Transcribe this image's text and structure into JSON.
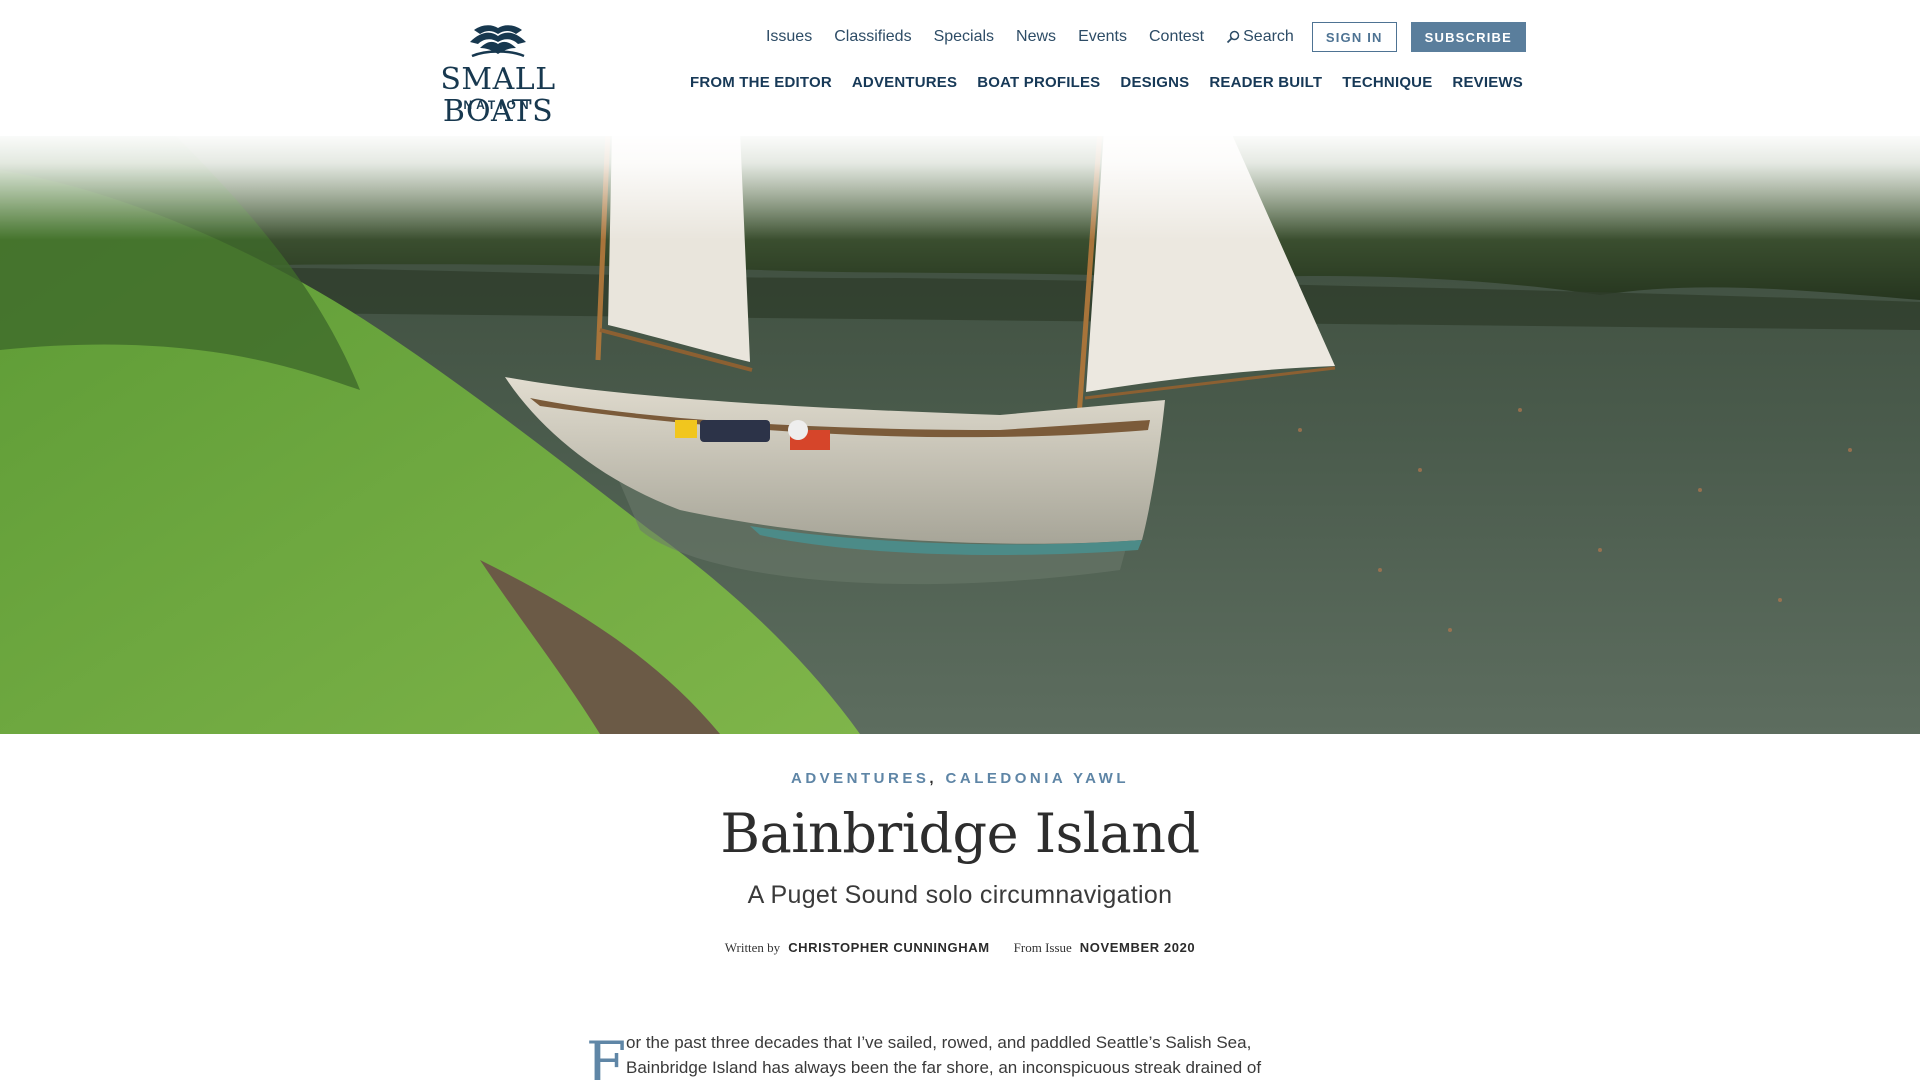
{
  "header": {
    "logo": {
      "title": "SMALL BOATS",
      "subtitle": "NATION"
    },
    "utility_nav": [
      "Issues",
      "Classifieds",
      "Specials",
      "News",
      "Events",
      "Contest"
    ],
    "search_label": "Search",
    "sign_in_label": "SIGN IN",
    "subscribe_label": "SUBSCRIBE",
    "main_nav": [
      "FROM THE EDITOR",
      "ADVENTURES",
      "BOAT PROFILES",
      "DESIGNS",
      "READER BUILT",
      "TECHNIQUE",
      "REVIEWS"
    ]
  },
  "article": {
    "categories": [
      "ADVENTURES",
      "CALEDONIA YAWL"
    ],
    "category_separator": ",",
    "title": "Bainbridge Island",
    "subtitle": "A Puget Sound solo circumnavigation",
    "byline": {
      "written_by_label": "Written by",
      "author": "CHRISTOPHER CUNNINGHAM",
      "from_issue_label": "From Issue",
      "issue": "NOVEMBER 2020"
    },
    "drop_cap": "F",
    "first_paragraph": "or the past three decades that I’ve sailed, rowed, and paddled Seattle’s Salish Sea, Bainbridge Island has always been the far shore, an inconspicuous streak drained of"
  },
  "colors": {
    "brand_navy": "#17384f",
    "accent_blue": "#5a7e9c",
    "category_blue": "#5e85a6"
  },
  "icons": {
    "logo_mark": "open-book-wave-icon",
    "search": "magnifier-icon"
  }
}
